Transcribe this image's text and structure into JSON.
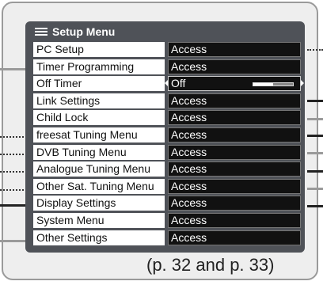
{
  "menu": {
    "title": "Setup Menu",
    "rows": [
      {
        "label": "PC Setup",
        "value": "Access"
      },
      {
        "label": "Timer Programming",
        "value": "Access"
      },
      {
        "label": "Off Timer",
        "value": "Off",
        "level": 0.5
      },
      {
        "label": "Link Settings",
        "value": "Access"
      },
      {
        "label": "Child Lock",
        "value": "Access"
      },
      {
        "label": "freesat Tuning Menu",
        "value": "Access"
      },
      {
        "label": "DVB Tuning Menu",
        "value": "Access"
      },
      {
        "label": "Analogue Tuning Menu",
        "value": "Access"
      },
      {
        "label": "Other Sat. Tuning Menu",
        "value": "Access"
      },
      {
        "label": "Display Settings",
        "value": "Access"
      },
      {
        "label": "System Menu",
        "value": "Access"
      },
      {
        "label": "Other Settings",
        "value": "Access"
      }
    ]
  },
  "footnote": "(p. 32 and p. 33)",
  "colors": {
    "panel": "#4f5258",
    "frame": "#eeeeee",
    "value_bg": "#111111"
  }
}
